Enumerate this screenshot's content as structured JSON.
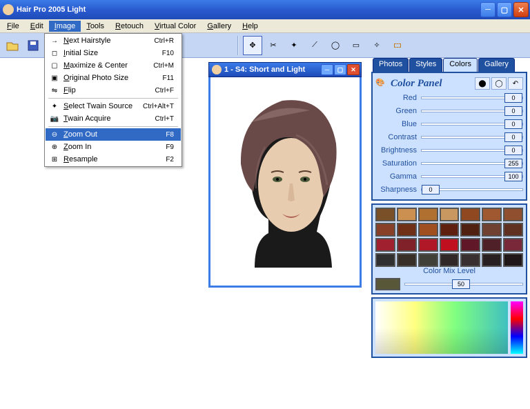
{
  "title": "Hair Pro 2005  Light",
  "menu": [
    "File",
    "Edit",
    "Image",
    "Tools",
    "Retouch",
    "Virtual Color",
    "Gallery",
    "Help"
  ],
  "menu_active": 2,
  "dropdown": [
    {
      "icon": "→",
      "label": "Next Hairstyle",
      "short": "Ctrl+R"
    },
    {
      "icon": "◻",
      "label": "Initial Size",
      "short": "F10"
    },
    {
      "icon": "▢",
      "label": "Maximize & Center",
      "short": "Ctrl+M"
    },
    {
      "icon": "▣",
      "label": "Original Photo Size",
      "short": "F11"
    },
    {
      "icon": "⇋",
      "label": "Flip",
      "short": "Ctrl+F"
    },
    "sep",
    {
      "icon": "✦",
      "label": "Select Twain Source",
      "short": "Ctrl+Alt+T"
    },
    {
      "icon": "📷",
      "label": "Twain Acquire",
      "short": "Ctrl+T"
    },
    "sep",
    {
      "icon": "⊖",
      "label": "Zoom Out",
      "short": "F8",
      "hover": true
    },
    {
      "icon": "⊕",
      "label": "Zoom In",
      "short": "F9"
    },
    {
      "icon": "⊞",
      "label": "Resample",
      "short": "F2"
    }
  ],
  "img_window": {
    "title": "1 - S4: Short and Light"
  },
  "side_tabs": [
    "Photos",
    "Styles",
    "Colors",
    "Gallery"
  ],
  "side_tab_active": 2,
  "color_panel": {
    "title": "Color Panel",
    "sliders": [
      {
        "name": "Red",
        "value": 0,
        "pos": "right"
      },
      {
        "name": "Green",
        "value": 0,
        "pos": "right"
      },
      {
        "name": "Blue",
        "value": 0,
        "pos": "right"
      },
      {
        "name": "Contrast",
        "value": 0,
        "pos": "right"
      },
      {
        "name": "Brightness",
        "value": 0,
        "pos": "right"
      },
      {
        "name": "Saturation",
        "value": 255,
        "pos": "right"
      },
      {
        "name": "Gamma",
        "value": 100,
        "pos": "right"
      },
      {
        "name": "Sharpness",
        "value": 0,
        "pos": "left"
      }
    ]
  },
  "swatches": [
    "#7a5028",
    "#cc9050",
    "#b07030",
    "#c89860",
    "#904820",
    "#a05830",
    "#905030",
    "#884028",
    "#703018",
    "#a05020",
    "#602010",
    "#502010",
    "#704030",
    "#603020",
    "#a02030",
    "#802028",
    "#b01828",
    "#c01020",
    "#601828",
    "#502028",
    "#782838",
    "#303030",
    "#383028",
    "#404038",
    "#302828",
    "#383030",
    "#282020",
    "#201818"
  ],
  "mix": {
    "label": "Color Mix Level",
    "value": 50,
    "preview": "#585838"
  }
}
